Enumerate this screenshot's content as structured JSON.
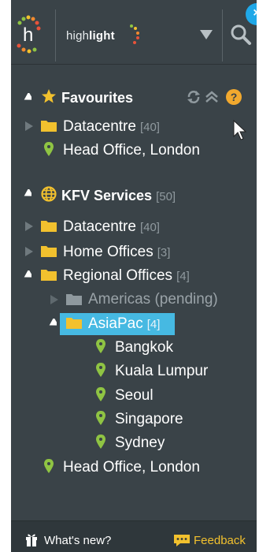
{
  "header": {
    "brand_prefix": "high",
    "brand_bold": "light",
    "close_label": "×"
  },
  "favourites": {
    "title": "Favourites",
    "items": [
      {
        "label": "Datacentre",
        "count": "[40]"
      },
      {
        "label": "Head Office, London"
      }
    ]
  },
  "services": {
    "title": "KFV Services",
    "count": "[50]",
    "items": [
      {
        "label": "Datacentre",
        "count": "[40]"
      },
      {
        "label": "Home Offices",
        "count": "[3]"
      },
      {
        "label": "Regional Offices",
        "count": "[4]"
      },
      {
        "label": "Americas (pending)"
      },
      {
        "label": "AsiaPac",
        "count": "[4]"
      },
      {
        "label": "Bangkok"
      },
      {
        "label": "Kuala Lumpur"
      },
      {
        "label": "Seoul"
      },
      {
        "label": "Singapore"
      },
      {
        "label": "Sydney"
      },
      {
        "label": "Head Office, London"
      }
    ]
  },
  "footer": {
    "whats_new": "What's new?",
    "feedback": "Feedback"
  },
  "colors": {
    "panel": "#3a4348",
    "accent": "#46b9e2",
    "folder": "#f2c12e",
    "pin": "#8fc443"
  }
}
